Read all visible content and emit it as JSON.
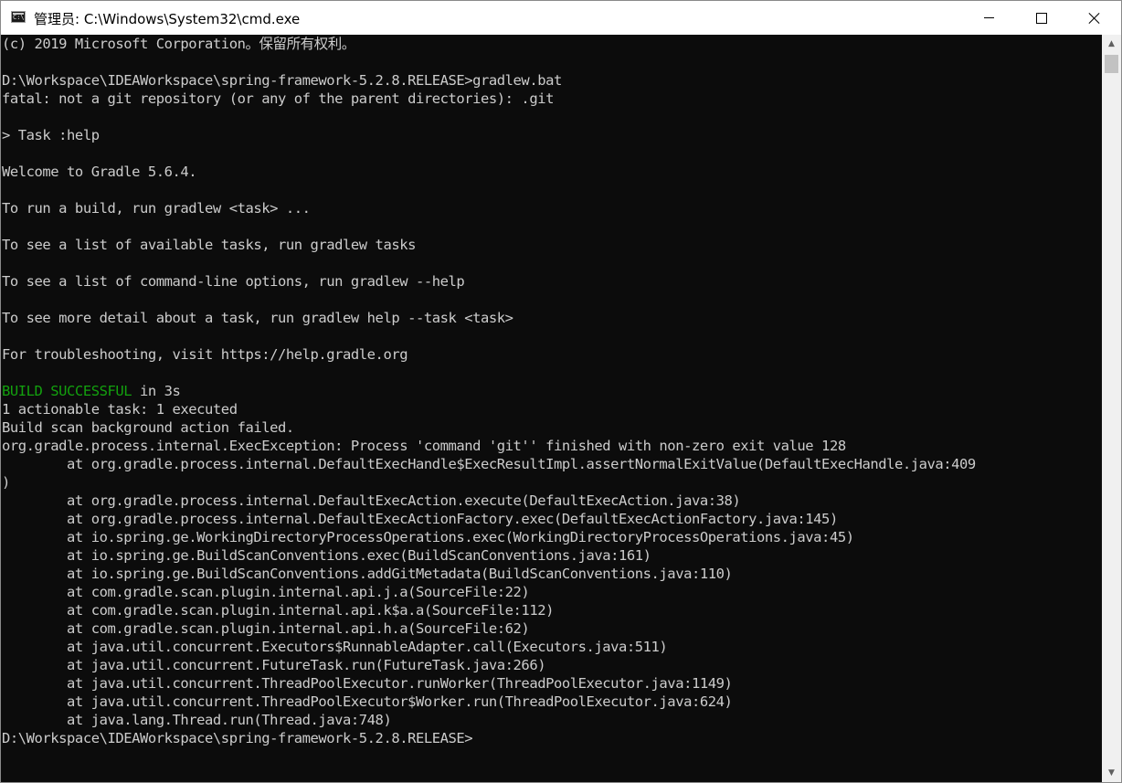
{
  "window": {
    "title": "管理员: C:\\Windows\\System32\\cmd.exe",
    "icon": "cmd-icon",
    "controls": {
      "minimize": "minimize-icon",
      "maximize": "maximize-icon",
      "close": "close-icon"
    }
  },
  "colors": {
    "background": "#0c0c0c",
    "text": "#cccccc",
    "success": "#13a10e"
  },
  "console": {
    "lines": [
      "(c) 2019 Microsoft Corporation。保留所有权利。",
      "",
      "D:\\Workspace\\IDEAWorkspace\\spring-framework-5.2.8.RELEASE>gradlew.bat",
      "fatal: not a git repository (or any of the parent directories): .git",
      "",
      "> Task :help",
      "",
      "Welcome to Gradle 5.6.4.",
      "",
      "To run a build, run gradlew <task> ...",
      "",
      "To see a list of available tasks, run gradlew tasks",
      "",
      "To see a list of command-line options, run gradlew --help",
      "",
      "To see more detail about a task, run gradlew help --task <task>",
      "",
      "For troubleshooting, visit https://help.gradle.org",
      "",
      "",
      "1 actionable task: 1 executed",
      "Build scan background action failed.",
      "org.gradle.process.internal.ExecException: Process 'command 'git'' finished with non-zero exit value 128",
      "        at org.gradle.process.internal.DefaultExecHandle$ExecResultImpl.assertNormalExitValue(DefaultExecHandle.java:409",
      ")",
      "        at org.gradle.process.internal.DefaultExecAction.execute(DefaultExecAction.java:38)",
      "        at org.gradle.process.internal.DefaultExecActionFactory.exec(DefaultExecActionFactory.java:145)",
      "        at io.spring.ge.WorkingDirectoryProcessOperations.exec(WorkingDirectoryProcessOperations.java:45)",
      "        at io.spring.ge.BuildScanConventions.exec(BuildScanConventions.java:161)",
      "        at io.spring.ge.BuildScanConventions.addGitMetadata(BuildScanConventions.java:110)",
      "        at com.gradle.scan.plugin.internal.api.j.a(SourceFile:22)",
      "        at com.gradle.scan.plugin.internal.api.k$a.a(SourceFile:112)",
      "        at com.gradle.scan.plugin.internal.api.h.a(SourceFile:62)",
      "        at java.util.concurrent.Executors$RunnableAdapter.call(Executors.java:511)",
      "        at java.util.concurrent.FutureTask.run(FutureTask.java:266)",
      "        at java.util.concurrent.ThreadPoolExecutor.runWorker(ThreadPoolExecutor.java:1149)",
      "        at java.util.concurrent.ThreadPoolExecutor$Worker.run(ThreadPoolExecutor.java:624)",
      "        at java.lang.Thread.run(Thread.java:748)",
      "D:\\Workspace\\IDEAWorkspace\\spring-framework-5.2.8.RELEASE>"
    ],
    "build_status": {
      "label": "BUILD SUCCESSFUL",
      "suffix": " in 3s"
    }
  }
}
